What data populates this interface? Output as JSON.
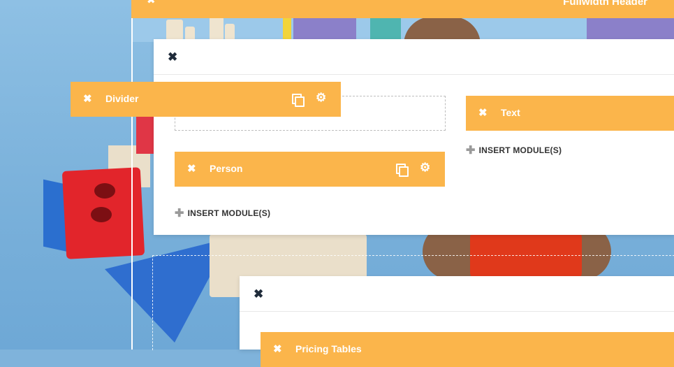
{
  "fullwidth_header": {
    "label": "Fullwidth Header",
    "close_icon": "✖"
  },
  "section_1": {
    "close_icon": "✖",
    "modules": {
      "divider": {
        "label": "Divider"
      },
      "person": {
        "label": "Person"
      },
      "text": {
        "label": "Text"
      }
    },
    "insert_left": "INSERT MODULE(S)",
    "insert_right": "INSERT MODULE(S)"
  },
  "section_2": {
    "close_icon": "✖",
    "modules": {
      "pricing": {
        "label": "Pricing Tables"
      }
    }
  },
  "icons": {
    "close": "✖",
    "settings": "⚙",
    "plus": "✚"
  },
  "colors": {
    "module": "#fbb54b",
    "section_bg": "#ffffff"
  }
}
